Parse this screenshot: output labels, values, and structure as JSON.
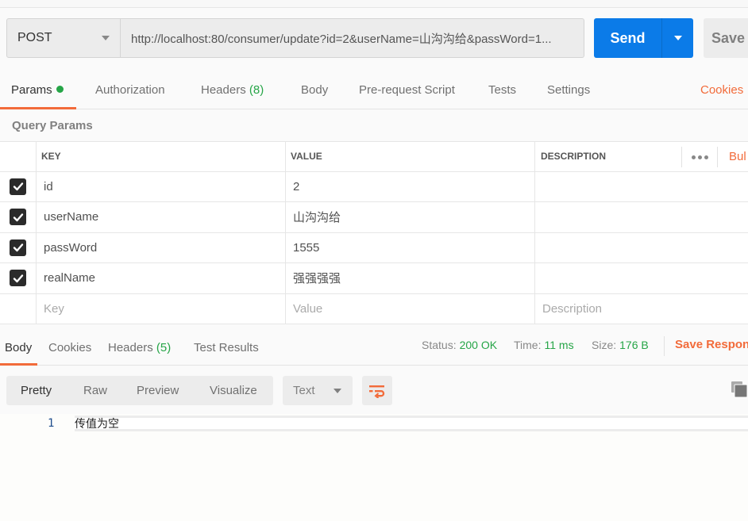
{
  "request": {
    "method": "POST",
    "url": "http://localhost:80/consumer/update?id=2&userName=山沟沟给&passWord=1...",
    "send_label": "Send",
    "save_label": "Save"
  },
  "request_tabs": [
    {
      "label": "Params",
      "active": true,
      "has_dot": true
    },
    {
      "label": "Authorization"
    },
    {
      "label": "Headers",
      "count": "(8)"
    },
    {
      "label": "Body"
    },
    {
      "label": "Pre-request Script"
    },
    {
      "label": "Tests"
    },
    {
      "label": "Settings"
    }
  ],
  "cookies_link": "Cookies",
  "query_params": {
    "title": "Query Params",
    "columns": {
      "key": "KEY",
      "value": "VALUE",
      "description": "DESCRIPTION"
    },
    "bulk_edit": "Bul",
    "rows": [
      {
        "checked": true,
        "key": "id",
        "value": "2",
        "description": ""
      },
      {
        "checked": true,
        "key": "userName",
        "value": "山沟沟给",
        "description": ""
      },
      {
        "checked": true,
        "key": "passWord",
        "value": "1555",
        "description": ""
      },
      {
        "checked": true,
        "key": "realName",
        "value": "强强强强",
        "description": ""
      }
    ],
    "placeholders": {
      "key": "Key",
      "value": "Value",
      "description": "Description"
    }
  },
  "response_tabs": [
    {
      "label": "Body",
      "active": true
    },
    {
      "label": "Cookies"
    },
    {
      "label": "Headers",
      "count": "(5)"
    },
    {
      "label": "Test Results"
    }
  ],
  "response_meta": {
    "status_label": "Status:",
    "status_value": "200 OK",
    "time_label": "Time:",
    "time_value": "11 ms",
    "size_label": "Size:",
    "size_value": "176 B",
    "save_response": "Save Respons"
  },
  "view_modes": [
    "Pretty",
    "Raw",
    "Preview",
    "Visualize"
  ],
  "format_select": "Text",
  "body_lines": [
    {
      "number": "1",
      "text": "传值为空"
    }
  ],
  "colors": {
    "accent": "#f26b3a",
    "send": "#0b7be8",
    "success": "#26a547"
  }
}
